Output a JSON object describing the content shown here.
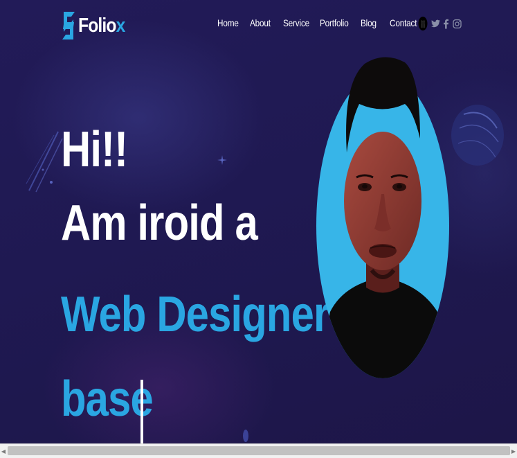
{
  "brand": {
    "logo_prefix": "Folio",
    "logo_suffix": "x"
  },
  "nav": {
    "items": [
      {
        "label": "Home"
      },
      {
        "label": "About"
      },
      {
        "label": "Service"
      },
      {
        "label": "Portfolio"
      },
      {
        "label": "Blog"
      },
      {
        "label": "Contact"
      }
    ]
  },
  "social": [
    "github-icon",
    "twitter-icon",
    "facebook-icon",
    "instagram-icon"
  ],
  "hero": {
    "line1": "Hi!!",
    "line2": "Am iroid a",
    "line3": "Web Designer",
    "line4": "base"
  },
  "colors": {
    "background": "#1f1952",
    "accent": "#2aa6e2",
    "portrait_circle": "#37b5e8",
    "text": "#ffffff"
  },
  "scrollbar": {
    "left_arrow": "◀",
    "right_arrow": "▶"
  }
}
